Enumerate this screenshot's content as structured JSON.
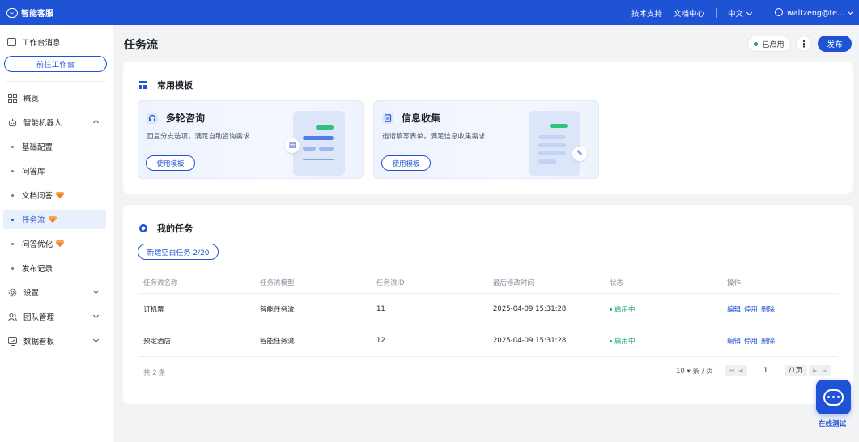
{
  "topbar": {
    "brand": "智能客服",
    "links": [
      "技术支持",
      "文档中心"
    ],
    "language": "中文",
    "user": "waltzeng@te..."
  },
  "sidebar": {
    "workspace_msg": "工作台消息",
    "goto_workspace": "前往工作台",
    "overview": "概览",
    "robot": "智能机器人",
    "robot_items": [
      "基础配置",
      "问答库",
      "文档问答",
      "任务流",
      "问答优化",
      "发布记录"
    ],
    "settings": "设置",
    "team": "团队管理",
    "dashboard": "数据看板"
  },
  "header": {
    "title": "任务流",
    "status": "已启用",
    "more": "⋮",
    "publish": "发布"
  },
  "templates": {
    "title": "常用模板",
    "items": [
      {
        "name": "多轮咨询",
        "desc": "回复分支选项，满足自助咨询需求",
        "button": "使用模板"
      },
      {
        "name": "信息收集",
        "desc": "邀请填写表单，满足信息收集需求",
        "button": "使用模板"
      }
    ]
  },
  "tasks": {
    "title": "我的任务",
    "new_button": "新建空白任务 2/20",
    "columns": [
      "任务流名称",
      "任务流模型",
      "任务流ID",
      "最后修改时间",
      "状态",
      "操作"
    ],
    "rows": [
      {
        "name": "订机票",
        "model": "智能任务流",
        "id": "11",
        "modified": "2025-04-09 15:31:28",
        "status": "启用中",
        "ops": [
          "编辑",
          "停用",
          "删除"
        ]
      },
      {
        "name": "预定酒店",
        "model": "智能任务流",
        "id": "12",
        "modified": "2025-04-09 15:31:28",
        "status": "启用中",
        "ops": [
          "编辑",
          "停用",
          "删除"
        ]
      }
    ],
    "total": "共 2 条",
    "page_size": "10 ▾ 条 / 页",
    "page": "1",
    "page_total": "/1页"
  },
  "float_widget": {
    "label": "在线测试"
  },
  "colors": {
    "primary": "#1f53d6",
    "success": "#1aa761",
    "vip": "#f07f2e"
  }
}
